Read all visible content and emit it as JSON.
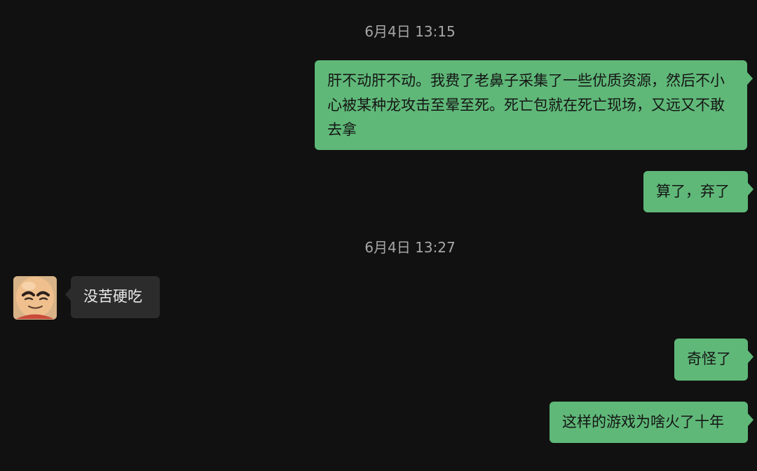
{
  "conversation": {
    "timestamps": [
      "6月4日 13:15",
      "6月4日 13:27"
    ],
    "messages": [
      {
        "direction": "outgoing",
        "text": "肝不动肝不动。我费了老鼻子采集了一些优质资源，然后不小心被某种龙攻击至晕至死。死亡包就在死亡现场，又远又不敢去拿"
      },
      {
        "direction": "outgoing",
        "text": "算了，弃了"
      },
      {
        "direction": "incoming",
        "text": "没苦硬吃",
        "avatar_icon": "bald-cartoon-avatar-icon"
      },
      {
        "direction": "outgoing",
        "text": "奇怪了"
      },
      {
        "direction": "outgoing",
        "text": "这样的游戏为啥火了十年"
      }
    ]
  },
  "colors": {
    "background": "#111111",
    "outgoing_bubble": "#5fb878",
    "incoming_bubble": "#2c2c2c",
    "timestamp_text": "#a7a7a7"
  }
}
